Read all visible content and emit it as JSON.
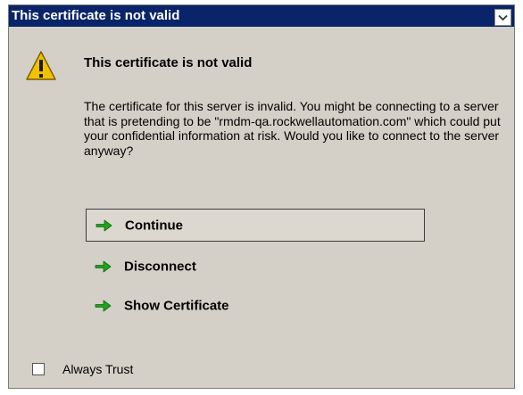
{
  "window": {
    "title": "This certificate is not valid",
    "title_button_icon": "chevron-down-icon"
  },
  "dialog": {
    "icon": "warning-icon",
    "heading": "This certificate is not valid",
    "message": "The certificate for this server is invalid. You might be connecting to a server that is pretending to be \"rmdm-qa.rockwellautomation.com\" which could put your confidential information at risk. Would you like to connect to the server anyway?"
  },
  "options": [
    {
      "label": "Continue",
      "icon": "green-arrow-icon",
      "selected": true
    },
    {
      "label": "Disconnect",
      "icon": "green-arrow-icon",
      "selected": false
    },
    {
      "label": "Show Certificate",
      "icon": "green-arrow-icon",
      "selected": false
    }
  ],
  "always_trust": {
    "label": "Always Trust",
    "checked": false
  },
  "colors": {
    "titlebar": "#0a246a",
    "dialog_bg": "#d4d0c8",
    "arrow_green": "#1fa31f",
    "warning_yellow": "#f2c200"
  }
}
